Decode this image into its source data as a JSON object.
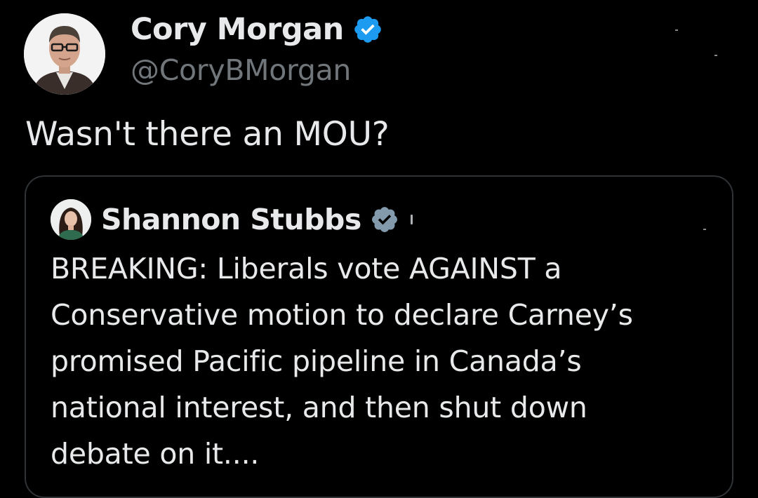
{
  "tweet": {
    "author": {
      "name": "Cory Morgan",
      "handle": "@CoryBMorgan",
      "verified": true
    },
    "text": "Wasn't there an MOU?",
    "quoted": {
      "author": {
        "name": "Shannon Stubbs",
        "verified": true
      },
      "text_lines": [
        "BREAKING: Liberals vote AGAINST a",
        "Conservative motion to declare Carney’s",
        "promised Pacific pipeline in Canada’s",
        "national interest, and then shut down",
        "debate on it...."
      ]
    }
  },
  "colors": {
    "background": "#000000",
    "primary_text": "#e7e9ea",
    "secondary_text": "#71767b",
    "verified_blue": "#1d9bf0",
    "verified_gray": "#829aab",
    "border": "#2f3336"
  },
  "icons": {
    "author_badge": "verified-badge-icon",
    "quoted_badge": "verified-badge-icon"
  }
}
